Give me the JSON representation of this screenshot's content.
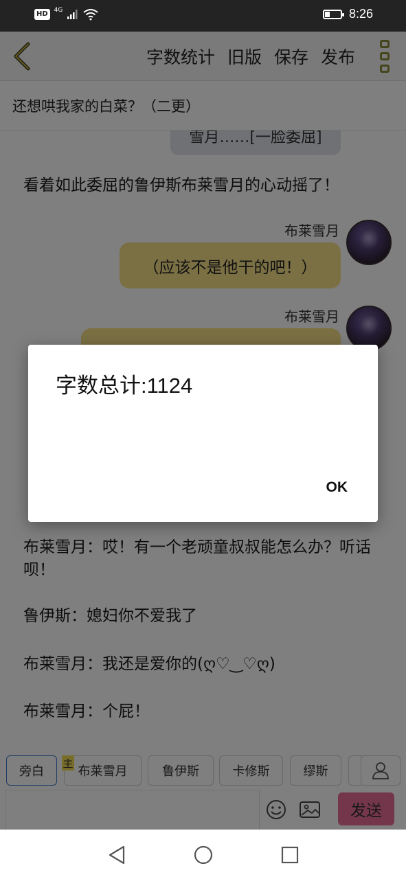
{
  "status_bar": {
    "hd_badge": "HD",
    "network": "4G",
    "time": "8:26"
  },
  "toolbar": {
    "actions": [
      "字数统计",
      "旧版",
      "保存",
      "发布"
    ]
  },
  "chapter": {
    "title": "还想哄我家的白菜？（二更）"
  },
  "content": {
    "top_bubble_text": "雪月……[一脸委屈]",
    "narration_1": "看着如此委屈的鲁伊斯布莱雪月的心动摇了！",
    "message_1": {
      "speaker": "布莱雪月",
      "text": "（应该不是他干的吧！）"
    },
    "message_2": {
      "speaker": "布莱雪月"
    },
    "dialogue": [
      "布莱雪月：哎！有一个老顽童叔叔能怎么办？听话呗！",
      "鲁伊斯：媳妇你不爱我了",
      "布莱雪月：我还是爱你的(ღ♡‿♡ღ)",
      "布莱雪月：个屁！"
    ]
  },
  "char_bar": {
    "main_tag": "主",
    "chips": [
      "旁白",
      "布莱雪月",
      "鲁伊斯",
      "卡修斯",
      "缪斯"
    ]
  },
  "input": {
    "send_label": "发送"
  },
  "dialog": {
    "message": "字数总计:1124",
    "ok_label": "OK"
  }
}
